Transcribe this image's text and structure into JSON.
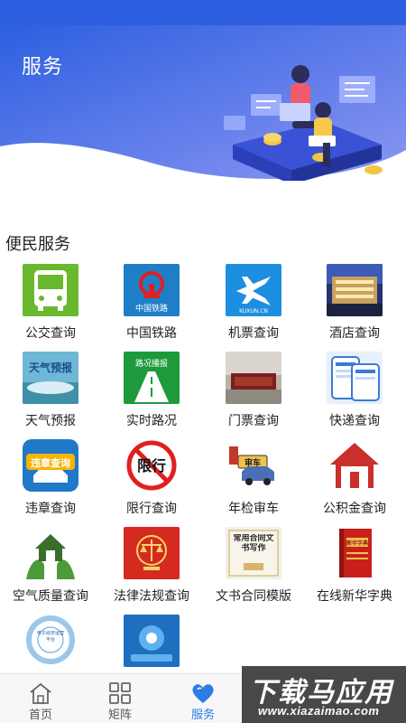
{
  "header": {
    "title": "服务"
  },
  "section": {
    "title": "便民服务"
  },
  "services": [
    {
      "label": "公交查询",
      "tile_text": ""
    },
    {
      "label": "中国铁路",
      "tile_text": "中国铁路"
    },
    {
      "label": "机票查询",
      "tile_text": "KUXUN.CN"
    },
    {
      "label": "酒店查询",
      "tile_text": ""
    },
    {
      "label": "天气预报",
      "tile_text": "天气预报"
    },
    {
      "label": "实时路况",
      "tile_text": "路况播报"
    },
    {
      "label": "门票查询",
      "tile_text": ""
    },
    {
      "label": "快递查询",
      "tile_text": ""
    },
    {
      "label": "违章查询",
      "tile_text": "违章查询"
    },
    {
      "label": "限行查询",
      "tile_text": "限行"
    },
    {
      "label": "年检审车",
      "tile_text": "审车"
    },
    {
      "label": "公积金查询",
      "tile_text": ""
    },
    {
      "label": "空气质量查询",
      "tile_text": ""
    },
    {
      "label": "法律法规查询",
      "tile_text": ""
    },
    {
      "label": "文书合同模版",
      "tile_text": "常用合同文书写作"
    },
    {
      "label": "在线新华字典",
      "tile_text": "新华字典"
    },
    {
      "label": "",
      "tile_text": "电子政务运营平台"
    },
    {
      "label": "",
      "tile_text": ""
    }
  ],
  "tabs": [
    {
      "label": "首页",
      "icon": "home-icon",
      "active": false
    },
    {
      "label": "矩阵",
      "icon": "grid-icon",
      "active": false
    },
    {
      "label": "服务",
      "icon": "heart-icon",
      "active": true
    }
  ],
  "watermark": {
    "main": "下载马应用",
    "sub": "www.xiazaimao.com"
  },
  "colors": {
    "primary": "#2d5fe0",
    "banner_light": "#7f8ef2",
    "active_tab": "#2d7be5"
  }
}
